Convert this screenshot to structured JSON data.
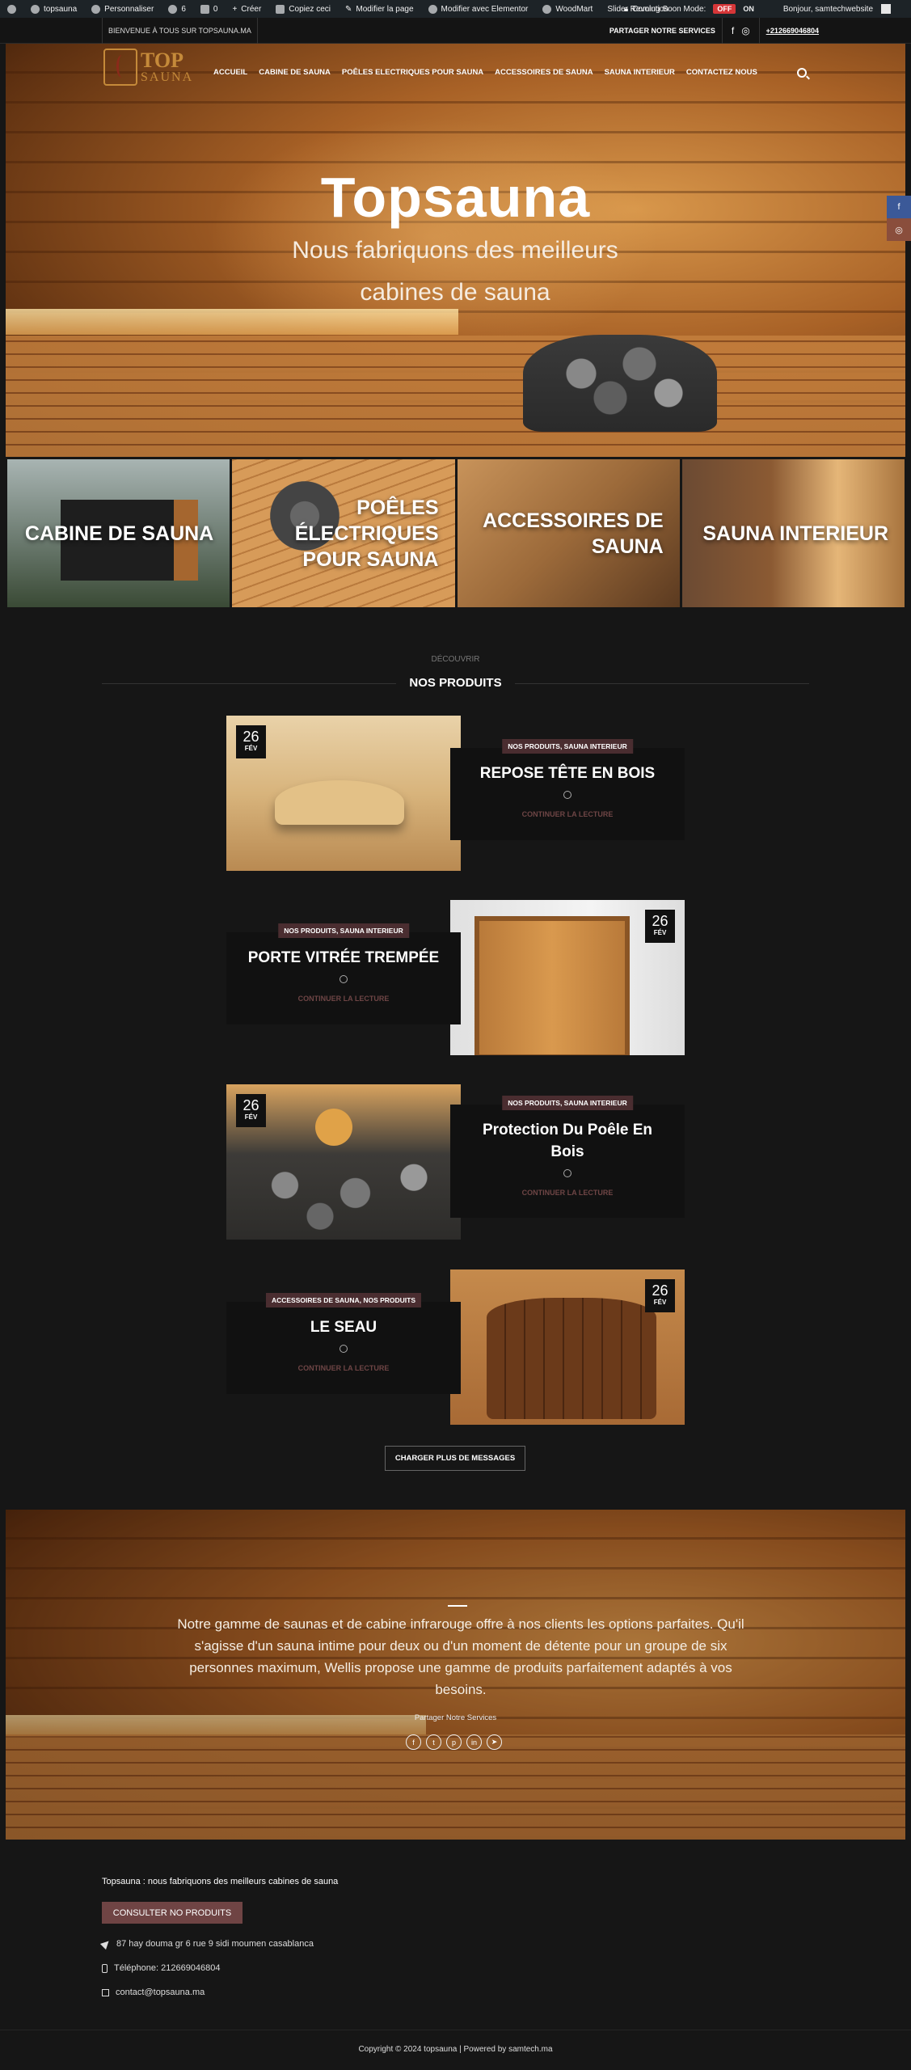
{
  "admin_bar": {
    "items": [
      "topsauna",
      "Personnaliser",
      "6",
      "0",
      "Créer",
      "Copiez ceci",
      "Modifier la page",
      "Modifier avec Elementor",
      "WoodMart",
      "Slider Revolution"
    ],
    "coming_soon_label": "Coming Soon Mode:",
    "off": "OFF",
    "on": "ON",
    "greeting": "Bonjour, samtechwebsite"
  },
  "topbar": {
    "welcome": "BIENVENUE À TOUS SUR TOPSAUNA.MA",
    "share": "PARTAGER NOTRE SERVICES",
    "phone": "+212669046804"
  },
  "logo": {
    "line1": "TOP",
    "line2": "SAUNA"
  },
  "nav": [
    "ACCUEIL",
    "CABINE DE SAUNA",
    "POÊLES ELECTRIQUES POUR SAUNA",
    "ACCESSOIRES DE SAUNA",
    "SAUNA INTERIEUR",
    "CONTACTEZ NOUS"
  ],
  "hero": {
    "title": "Topsauna",
    "subtitle": "Nous fabriquons des meilleurs cabines de sauna"
  },
  "side_social": {
    "facebook": "f",
    "instagram": "◎"
  },
  "categories": [
    "CABINE DE SAUNA",
    "POÊLES ÉLECTRIQUES POUR SAUNA",
    "ACCESSOIRES DE SAUNA",
    "SAUNA INTERIEUR"
  ],
  "products_section": {
    "subtitle": "DÉCOUVRIR",
    "title": "NOS PRODUITS"
  },
  "posts": [
    {
      "day": "26",
      "month": "FÉV",
      "category": "NOS PRODUITS, SAUNA INTERIEUR",
      "title": "REPOSE TÊTE EN BOIS",
      "more": "CONTINUER LA LECTURE"
    },
    {
      "day": "26",
      "month": "FÉV",
      "category": "NOS PRODUITS, SAUNA INTERIEUR",
      "title": "PORTE VITRÉE TREMPÉE",
      "more": "CONTINUER LA LECTURE"
    },
    {
      "day": "26",
      "month": "FÉV",
      "category": "NOS PRODUITS, SAUNA INTERIEUR",
      "title": "Protection Du Poêle En Bois",
      "more": "CONTINUER LA LECTURE"
    },
    {
      "day": "26",
      "month": "FÉV",
      "category": "ACCESSOIRES DE SAUNA, NOS PRODUITS",
      "title": "LE SEAU",
      "more": "CONTINUER LA LECTURE"
    }
  ],
  "load_more": "CHARGER PLUS DE MESSAGES",
  "banner": {
    "text": "Notre gamme de saunas et de cabine infrarouge offre à nos clients les options parfaites. Qu'il s'agisse d'un sauna intime pour deux ou d'un moment de détente pour un groupe de six personnes maximum, Wellis propose une gamme de produits parfaitement adaptés à vos besoins.",
    "share_label": "Partager Notre Services",
    "icons": [
      "f",
      "t",
      "p",
      "in",
      "➤"
    ]
  },
  "footer": {
    "title": "Topsauna : nous fabriquons des meilleurs cabines de sauna",
    "button": "CONSULTER NO PRODUITS",
    "address": "87 hay douma gr 6 rue 9 sidi moumen casablanca",
    "phone": "Téléphone: 212669046804",
    "email": "contact@topsauna.ma",
    "copyright": "Copyright © 2024 topsauna | Powered by samtech.ma"
  },
  "colors": {
    "background": "#161616",
    "accent": "#6f4444",
    "badge": "#4a2d30",
    "admin_bar": "#1d2327",
    "off_badge": "#d63638"
  }
}
